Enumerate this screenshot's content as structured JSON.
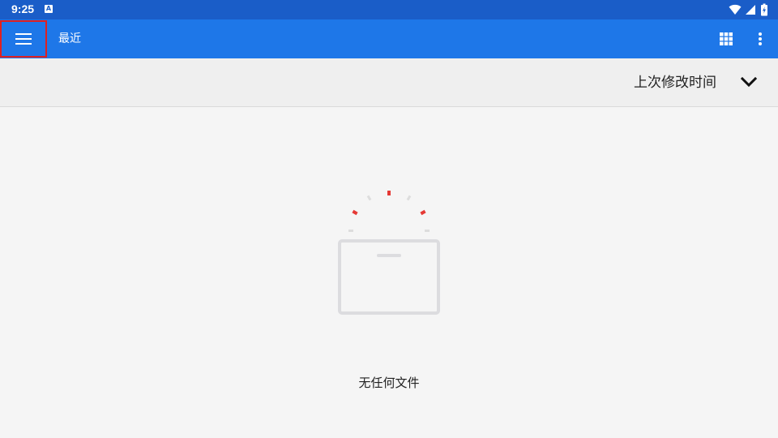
{
  "status_bar": {
    "time": "9:25",
    "notification_icon_letter": "A",
    "icons": [
      "wifi-icon",
      "signal-icon",
      "battery-icon"
    ]
  },
  "app_bar": {
    "title": "最近",
    "menu_icon": "hamburger-menu-icon",
    "grid_icon": "grid-view-icon",
    "more_icon": "more-vert-icon",
    "background": "#1e77e8"
  },
  "sort_bar": {
    "label": "上次修改时间",
    "chevron_icon": "chevron-down-icon"
  },
  "empty_state": {
    "message": "无任何文件",
    "illustration_icon": "empty-box-icon"
  },
  "colors": {
    "status_bar": "#1a5dc8",
    "app_bar": "#1e77e8",
    "accent_red": "#e53935",
    "highlight_border": "#e02020"
  }
}
